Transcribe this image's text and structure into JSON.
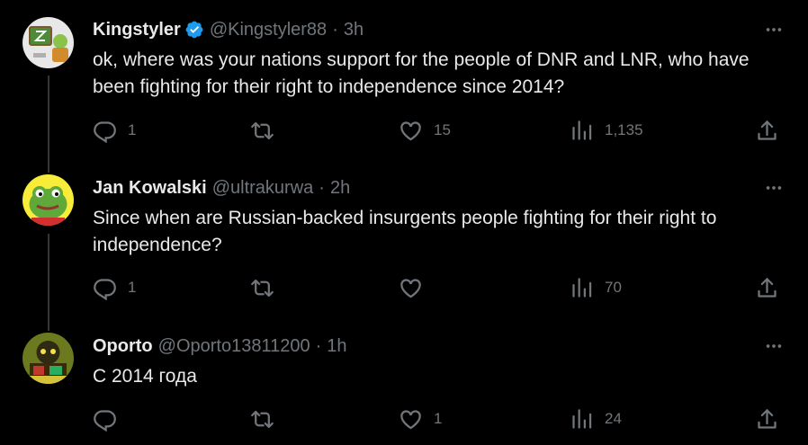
{
  "colors": {
    "background": "#000000",
    "text": "#e7e9ea",
    "muted": "#71767b",
    "verified": "#1d9bf0",
    "thread_line": "#333639"
  },
  "tweets": [
    {
      "name": "Kingstyler",
      "verified": true,
      "handle": "@Kingstyler88",
      "separator": "·",
      "time": "3h",
      "text": "ok, where was your nations support for the people of DNR and LNR, who have been fighting for their right to independence since 2014?",
      "replies": "1",
      "retweets": "",
      "likes": "15",
      "views": "1,135"
    },
    {
      "name": "Jan Kowalski",
      "verified": false,
      "handle": "@ultrakurwa",
      "separator": "·",
      "time": "2h",
      "text": "Since when are Russian-backed insurgents people fighting for their right to independence?",
      "replies": "1",
      "retweets": "",
      "likes": "",
      "views": "70"
    },
    {
      "name": "Oporto",
      "verified": false,
      "handle": "@Oporto13811200",
      "separator": "·",
      "time": "1h",
      "text": "С 2014 года",
      "replies": "",
      "retweets": "",
      "likes": "1",
      "views": "24"
    }
  ],
  "icons": {
    "more": "more-horizontal-icon",
    "reply": "reply-icon",
    "retweet": "retweet-icon",
    "like": "heart-icon",
    "views": "views-chart-icon",
    "share": "share-icon",
    "verified": "verified-badge-icon"
  }
}
